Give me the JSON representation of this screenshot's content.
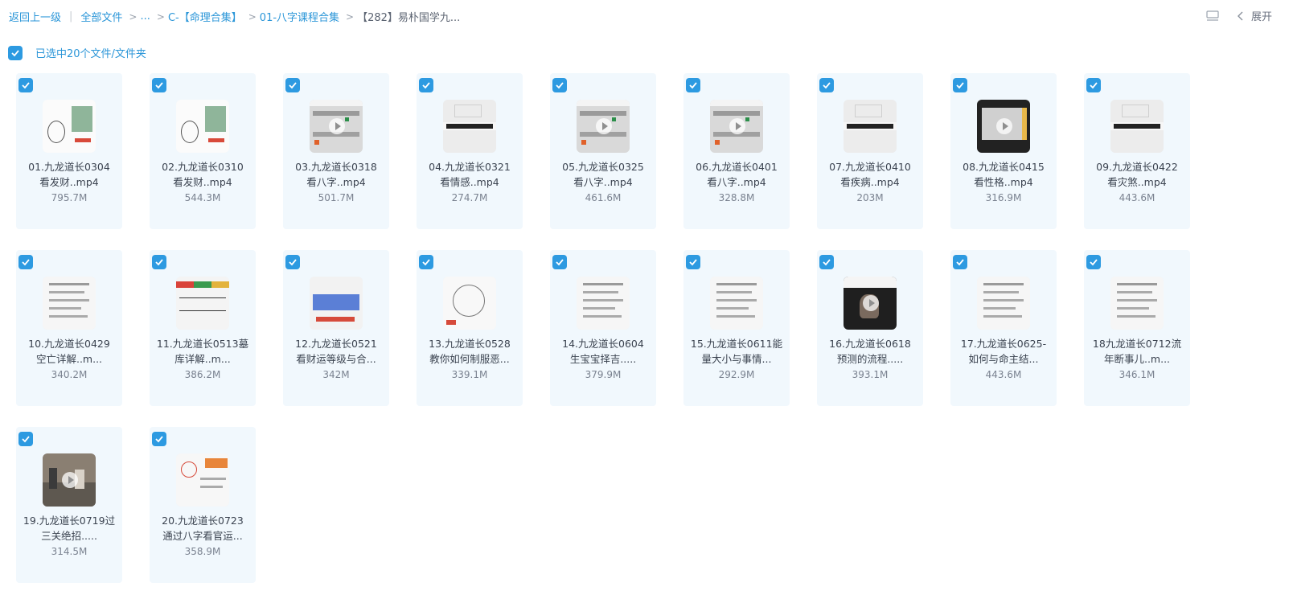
{
  "breadcrumb": {
    "back": "返回上一级",
    "all_files": "全部文件",
    "ellipsis": "...",
    "level1": "C-【命理合集】",
    "level2": "01-八字课程合集",
    "current": "【282】易朴国学九..."
  },
  "toolbar": {
    "expand_label": "展开"
  },
  "selection": {
    "summary": "已选中20个文件/文件夹"
  },
  "files": [
    {
      "name": "01.九龙道长0304\n看发财..mp4",
      "size": "795.7M",
      "selected": true,
      "thumb": "a"
    },
    {
      "name": "02.九龙道长0310\n看发财..mp4",
      "size": "544.3M",
      "selected": true,
      "thumb": "a"
    },
    {
      "name": "03.九龙道长0318\n看八字..mp4",
      "size": "501.7M",
      "selected": true,
      "thumb": "b"
    },
    {
      "name": "04.九龙道长0321\n看情感..mp4",
      "size": "274.7M",
      "selected": true,
      "thumb": "c"
    },
    {
      "name": "05.九龙道长0325\n看八字..mp4",
      "size": "461.6M",
      "selected": true,
      "thumb": "b"
    },
    {
      "name": "06.九龙道长0401\n看八字..mp4",
      "size": "328.8M",
      "selected": true,
      "thumb": "b"
    },
    {
      "name": "07.九龙道长0410\n看疾病..mp4",
      "size": "203M",
      "selected": true,
      "thumb": "c"
    },
    {
      "name": "08.九龙道长0415\n看性格..mp4",
      "size": "316.9M",
      "selected": true,
      "thumb": "d"
    },
    {
      "name": "09.九龙道长0422\n看灾煞..mp4",
      "size": "443.6M",
      "selected": true,
      "thumb": "c"
    },
    {
      "name": "10.九龙道长0429\n空亡详解..m...",
      "size": "340.2M",
      "selected": true,
      "thumb": "e"
    },
    {
      "name": "11.九龙道长0513墓\n库详解..m...",
      "size": "386.2M",
      "selected": true,
      "thumb": "f"
    },
    {
      "name": "12.九龙道长0521\n看财运等级与合...",
      "size": "342M",
      "selected": true,
      "thumb": "g"
    },
    {
      "name": "13.九龙道长0528\n教你如何制服恶...",
      "size": "339.1M",
      "selected": true,
      "thumb": "h"
    },
    {
      "name": "14.九龙道长0604\n生宝宝择吉.....",
      "size": "379.9M",
      "selected": true,
      "thumb": "e"
    },
    {
      "name": "15.九龙道长0611能\n量大小与事情...",
      "size": "292.9M",
      "selected": true,
      "thumb": "e"
    },
    {
      "name": "16.九龙道长0618\n预测的流程.....",
      "size": "393.1M",
      "selected": true,
      "thumb": "i"
    },
    {
      "name": "17.九龙道长0625-\n如何与命主结...",
      "size": "443.6M",
      "selected": true,
      "thumb": "e"
    },
    {
      "name": "18九龙道长0712流\n年断事儿..m...",
      "size": "346.1M",
      "selected": true,
      "thumb": "e"
    },
    {
      "name": "19.九龙道长0719过\n三关绝招.....",
      "size": "314.5M",
      "selected": true,
      "thumb": "j"
    },
    {
      "name": "20.九龙道长0723\n通过八字看官运...",
      "size": "358.9M",
      "selected": true,
      "thumb": "k"
    }
  ],
  "colors": {
    "accent": "#2d9ae1",
    "link": "#2b96d8",
    "card_bg": "#f1f8fd"
  }
}
